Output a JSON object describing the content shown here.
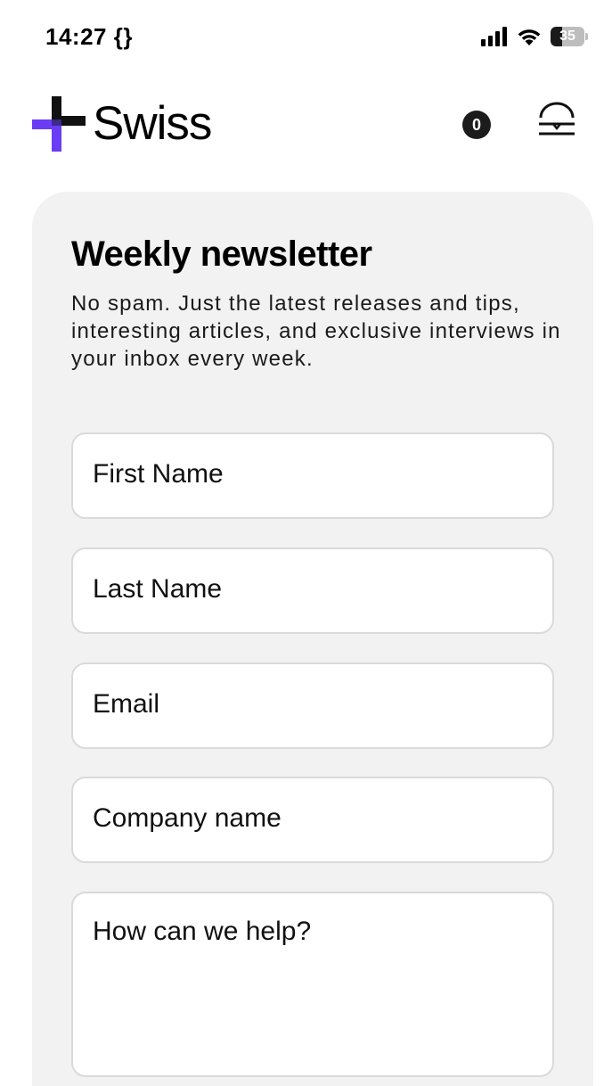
{
  "status_bar": {
    "time": "14:27 {}",
    "battery_level": "35",
    "battery_fraction": 0.35,
    "icons": [
      "signal-icon",
      "wifi-icon",
      "battery-icon"
    ]
  },
  "header": {
    "logo_text": "Swiss",
    "cart_count": "0",
    "logo_colors": {
      "accent": "#6b3cf5",
      "dark": "#111111"
    }
  },
  "newsletter": {
    "title": "Weekly newsletter",
    "description": "No spam. Just the latest releases and tips, interesting articles, and exclusive interviews in your inbox every week.",
    "fields": {
      "first_name": {
        "placeholder": "First Name",
        "value": ""
      },
      "last_name": {
        "placeholder": "Last Name",
        "value": ""
      },
      "email": {
        "placeholder": "Email",
        "value": ""
      },
      "company": {
        "placeholder": "Company name",
        "value": ""
      },
      "message": {
        "placeholder": "How can we help?",
        "value": ""
      }
    }
  }
}
